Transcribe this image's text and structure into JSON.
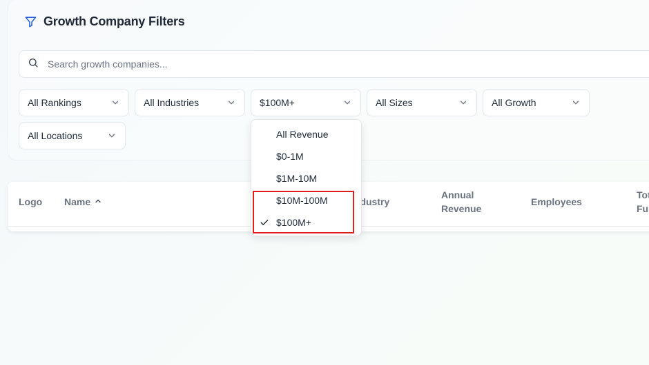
{
  "header": {
    "title": "Growth Company Filters",
    "icon": "filter-icon"
  },
  "search": {
    "placeholder": "Search growth companies...",
    "value": ""
  },
  "filters": [
    {
      "label": "All Rankings"
    },
    {
      "label": "All Industries"
    },
    {
      "label": "$100M+"
    },
    {
      "label": "All Sizes"
    },
    {
      "label": "All Growth"
    },
    {
      "label": "All Locations"
    }
  ],
  "revenue_dropdown": {
    "options": [
      "All Revenue",
      "$0-1M",
      "$1M-10M",
      "$10M-100M",
      "$100M+"
    ],
    "selected": "$100M+"
  },
  "table": {
    "headers": {
      "logo": "Logo",
      "name": "Name",
      "industry": "Industry",
      "annual_revenue_1": "Annual",
      "annual_revenue_2": "Revenue",
      "employees": "Employees",
      "total_funding_1": "Total",
      "total_funding_2": "Funding"
    }
  },
  "colors": {
    "accent": "#2563eb",
    "highlight": "#e11d1d"
  }
}
